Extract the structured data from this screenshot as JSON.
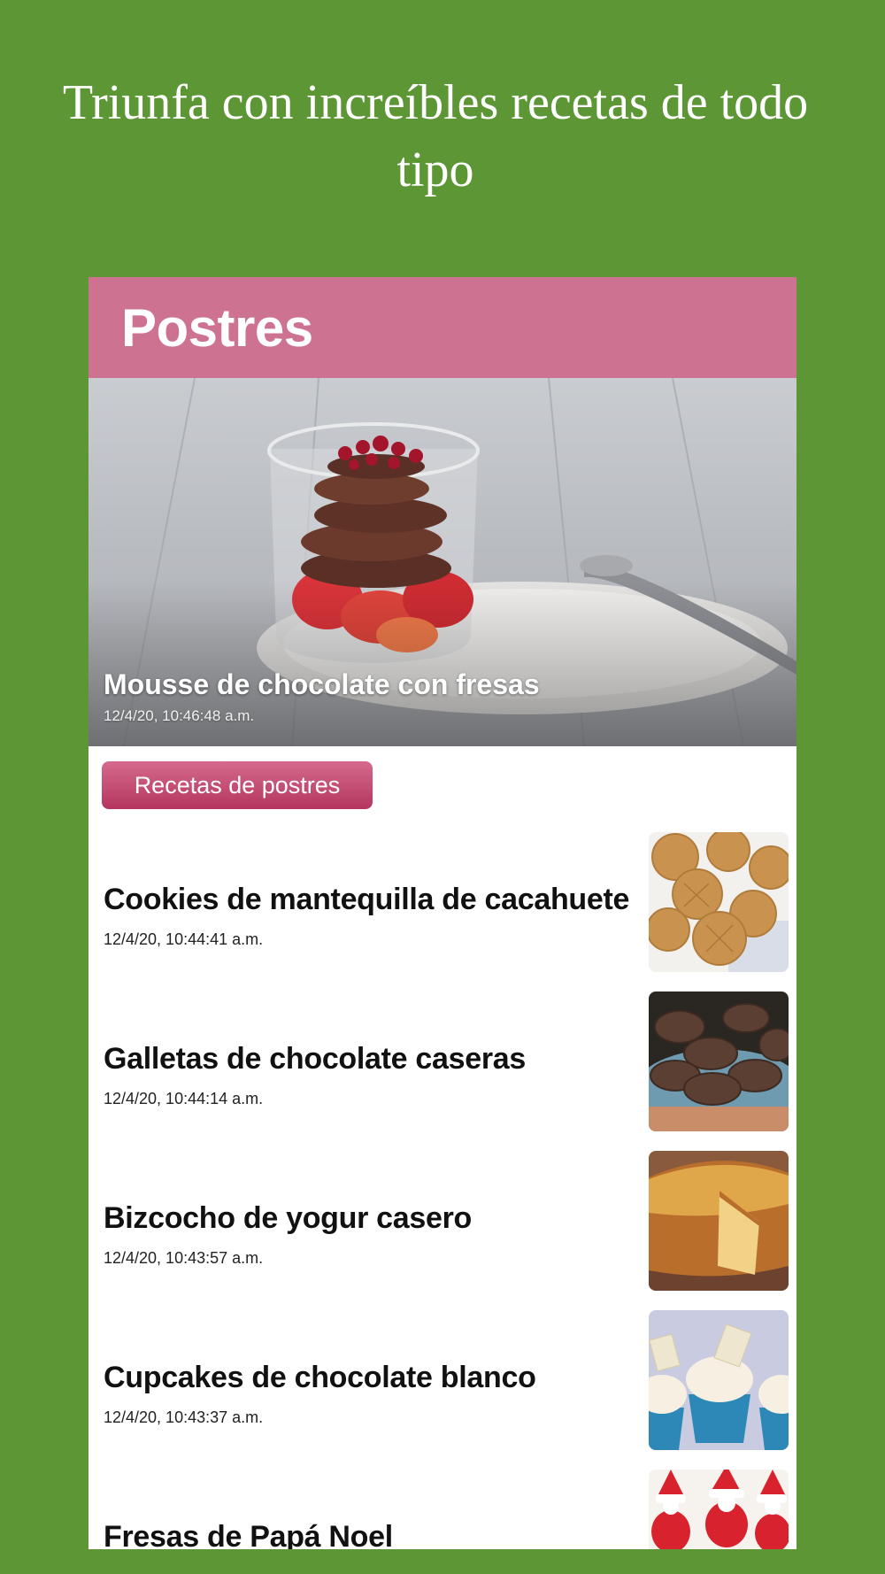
{
  "headline": "Triunfa con increíbles recetas de todo tipo",
  "app": {
    "header_title": "Postres",
    "colors": {
      "background": "#5c9635",
      "header": "#cd7290",
      "button": "#c04a72"
    }
  },
  "hero": {
    "title": "Mousse de chocolate con fresas",
    "date": "12/4/20, 10:46:48 a.m.",
    "image_icon": "chocolate-mousse-photo"
  },
  "category_button": {
    "label": "Recetas de postres"
  },
  "recipes": [
    {
      "title": "Cookies de mantequilla de cacahuete",
      "date": "12/4/20, 10:44:41 a.m.",
      "image_icon": "peanut-butter-cookies-photo"
    },
    {
      "title": "Galletas de chocolate caseras",
      "date": "12/4/20, 10:44:14 a.m.",
      "image_icon": "chocolate-cookies-photo"
    },
    {
      "title": "Bizcocho de yogur casero",
      "date": "12/4/20, 10:43:57 a.m.",
      "image_icon": "yogurt-cake-photo"
    },
    {
      "title": "Cupcakes de chocolate blanco",
      "date": "12/4/20, 10:43:37 a.m.",
      "image_icon": "white-chocolate-cupcakes-photo"
    },
    {
      "title": "Fresas de Papá Noel",
      "date": "",
      "image_icon": "santa-strawberries-photo"
    }
  ]
}
